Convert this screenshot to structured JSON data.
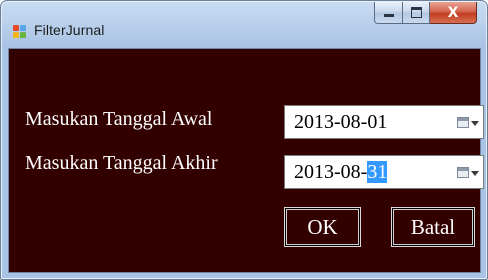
{
  "window": {
    "title": "FilterJurnal",
    "icon": "form-app-icon",
    "controls": {
      "minimize": "—",
      "maximize": "▭",
      "close": "X"
    }
  },
  "form": {
    "start_label": "Masukan Tanggal Awal",
    "end_label": "Masukan Tanggal Akhir",
    "start_date": "2013-08-01",
    "end_date_prefix": "2013-08-",
    "end_date_selected": "31",
    "ok_label": "OK",
    "cancel_label": "Batal"
  },
  "colors": {
    "client_background": "#330000",
    "selection": "#3399ff",
    "close_button": "#c7432a"
  }
}
